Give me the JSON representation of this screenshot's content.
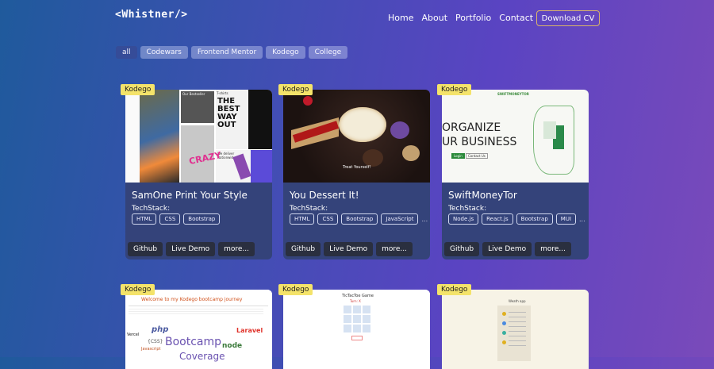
{
  "header": {
    "logo": "<Whistner/>",
    "nav": [
      "Home",
      "About",
      "Portfolio",
      "Contact"
    ],
    "download": "Download CV"
  },
  "filters": [
    "all",
    "Codewars",
    "Frontend Mentor",
    "Kodego",
    "College"
  ],
  "cards": [
    {
      "badge": "Kodego",
      "title": "SamOne Print Your Style",
      "techstack_label": "TechStack:",
      "chips": [
        "HTML",
        "CSS",
        "Bootstrap"
      ],
      "more_chips": "",
      "buttons": [
        "Github",
        "Live Demo",
        "more..."
      ],
      "thumb_text": {
        "a": "Our Bestseller",
        "b": "T-shirts",
        "big": "THE BEST WAY OUT",
        "c": "We deliver Nationwide",
        "d": "CRAZY"
      }
    },
    {
      "badge": "Kodego",
      "title": "You Dessert It!",
      "techstack_label": "TechStack:",
      "chips": [
        "HTML",
        "CSS",
        "Bootstrap",
        "JavaScript"
      ],
      "more_chips": "...",
      "buttons": [
        "Github",
        "Live Demo",
        "more..."
      ],
      "thumb_text": {
        "a": "Treat Yourself!"
      }
    },
    {
      "badge": "Kodego",
      "title": "SwiftMoneyTor",
      "techstack_label": "TechStack:",
      "chips": [
        "Node.js",
        "React.js",
        "Bootstrap",
        "MUI"
      ],
      "more_chips": "...",
      "buttons": [
        "Github",
        "Live Demo",
        "more..."
      ],
      "thumb_text": {
        "logo": "SWIFTMONEYTOR",
        "h1": "ORGANIZE",
        "h2": "UR BUSINESS",
        "login": "Login",
        "contact": "Contact Us"
      }
    }
  ],
  "lower_cards": [
    {
      "badge": "Kodego",
      "thumb_text": {
        "title": "Welcome to my Kodego bootcamp journey",
        "php": "php",
        "laravel": "Laravel",
        "css": "{CSS}",
        "bootcamp": "Bootcamp",
        "node": "node",
        "vercel": "Vercel",
        "js": "Javascript",
        "coverage": "Coverage"
      }
    },
    {
      "badge": "Kodego",
      "thumb_text": {
        "title": "TicTacToe Game",
        "sub": "Turn: X"
      }
    },
    {
      "badge": "Kodego",
      "thumb_text": {
        "title": "Weath app"
      }
    }
  ],
  "colors": {
    "badge": "#f4e36a",
    "card": "#34437a",
    "button": "#2a2f3f",
    "accent_border": "#d9b36a"
  }
}
